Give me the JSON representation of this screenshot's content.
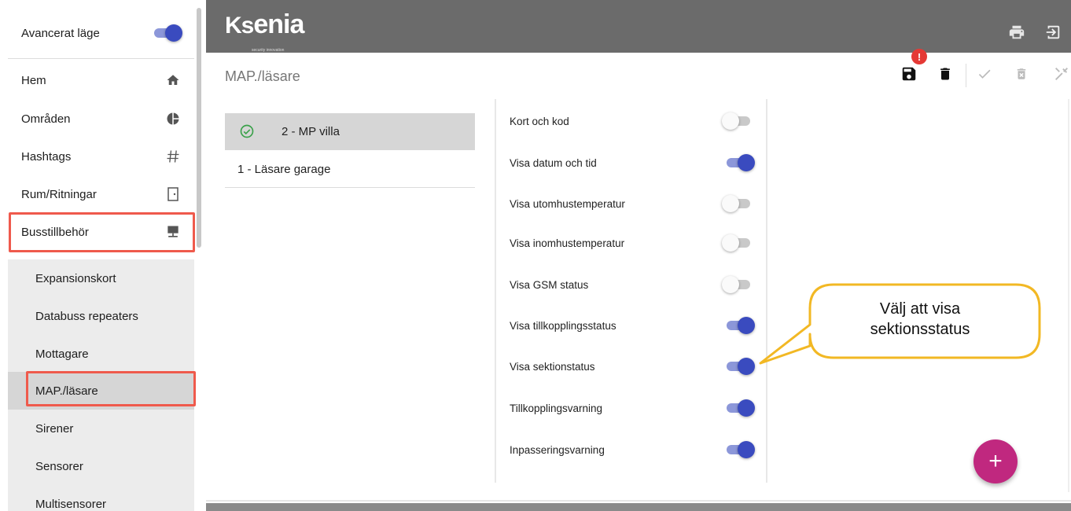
{
  "sidebar": {
    "advanced": {
      "label": "Avancerat läge",
      "on": true
    },
    "items": [
      {
        "label": "Hem",
        "icon": "home-icon"
      },
      {
        "label": "Områden",
        "icon": "pie-chart-icon"
      },
      {
        "label": "Hashtags",
        "icon": "hash-icon"
      },
      {
        "label": "Rum/Ritningar",
        "icon": "door-icon"
      },
      {
        "label": "Busstillbehör",
        "icon": "desktop-icon"
      }
    ],
    "subitems": [
      {
        "label": "Expansionskort"
      },
      {
        "label": "Databuss repeaters"
      },
      {
        "label": "Mottagare"
      },
      {
        "label": "MAP./läsare",
        "active": true
      },
      {
        "label": "Sirener"
      },
      {
        "label": "Sensorer"
      },
      {
        "label": "Multisensorer"
      }
    ]
  },
  "header": {
    "logo_main": "enia",
    "logo_ks": "Ks",
    "logo_sub": "security innovation",
    "icons": [
      "print-icon",
      "logout-icon"
    ]
  },
  "page": {
    "title": "MAP./läsare",
    "save_badge": "!",
    "actions": [
      "save-icon",
      "delete-icon",
      "check-icon",
      "discard-icon",
      "tools-icon"
    ]
  },
  "devices": [
    {
      "name": "2 - MP villa",
      "selected": true,
      "status": "ok"
    },
    {
      "name": "1 - Läsare garage",
      "selected": false
    }
  ],
  "options": [
    {
      "label": "Kort och kod",
      "on": false
    },
    {
      "label": "Visa datum och tid",
      "on": true
    },
    {
      "label": "Visa utomhustemperatur",
      "on": false
    },
    {
      "label": "Visa inomhustemperatur",
      "on": false
    },
    {
      "label": "Visa GSM status",
      "on": false
    },
    {
      "label": "Visa tillkopplingsstatus",
      "on": true
    },
    {
      "label": "Visa sektionstatus",
      "on": true
    },
    {
      "label": "Tillkopplingsvarning",
      "on": true
    },
    {
      "label": "Inpasseringsvarning",
      "on": true
    }
  ],
  "callout": {
    "line1": "Välj att visa",
    "line2": "sektionsstatus"
  },
  "fab": {
    "label": "+"
  },
  "colors": {
    "accent": "#3a4bbf",
    "fab": "#c0287f",
    "highlight": "#ef5a4c",
    "callout": "#f2b824",
    "topbar": "#6b6b6b"
  }
}
